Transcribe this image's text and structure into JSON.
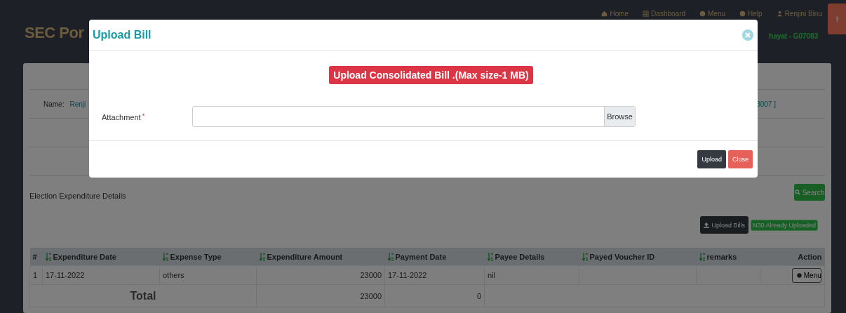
{
  "header": {
    "title": "SEC Por",
    "nav": [
      {
        "label": "Home"
      },
      {
        "label": "Dashboard"
      },
      {
        "label": "Menu"
      },
      {
        "label": "Help"
      },
      {
        "label": "Renjini Binu"
      }
    ],
    "subtitle": "hayat - G07083"
  },
  "panel": {
    "name_label": "Name:",
    "name_value": "Renji",
    "code": "3007 ]",
    "section_title": "Election Expenditure Details",
    "search_button": "Search",
    "upload_button": "Upload Bills",
    "upload_badge": "N30 Already Uploaded"
  },
  "table": {
    "columns": [
      {
        "label": "#",
        "sortable": false
      },
      {
        "label": "Expenditure Date",
        "sortable": true
      },
      {
        "label": "Expense Type",
        "sortable": true
      },
      {
        "label": "Expenditure Amount",
        "sortable": true
      },
      {
        "label": "Payment Date",
        "sortable": true
      },
      {
        "label": "Payee Details",
        "sortable": true
      },
      {
        "label": "Payed Voucher ID",
        "sortable": true
      },
      {
        "label": "remarks",
        "sortable": true
      },
      {
        "label": "Action",
        "sortable": false
      }
    ],
    "rows": [
      {
        "index": "1",
        "expenditure_date": "17-11-2022",
        "expense_type": "others",
        "expenditure_amount": "23000",
        "payment_date": "17-11-2022",
        "payee_details": "nil",
        "action": "Menu"
      }
    ],
    "total": {
      "label": "Total",
      "amount": "23000",
      "payment": "0"
    }
  },
  "modal": {
    "title": "Upload Bill",
    "notice": "Upload Consolidated Bill .(Max size-1 MB)",
    "field": {
      "label": "Attachment",
      "required_mark": "*",
      "browse": "Browse"
    },
    "buttons": [
      {
        "kind": "primary",
        "label": "Upload"
      },
      {
        "kind": "danger",
        "label": "Close"
      }
    ]
  }
}
